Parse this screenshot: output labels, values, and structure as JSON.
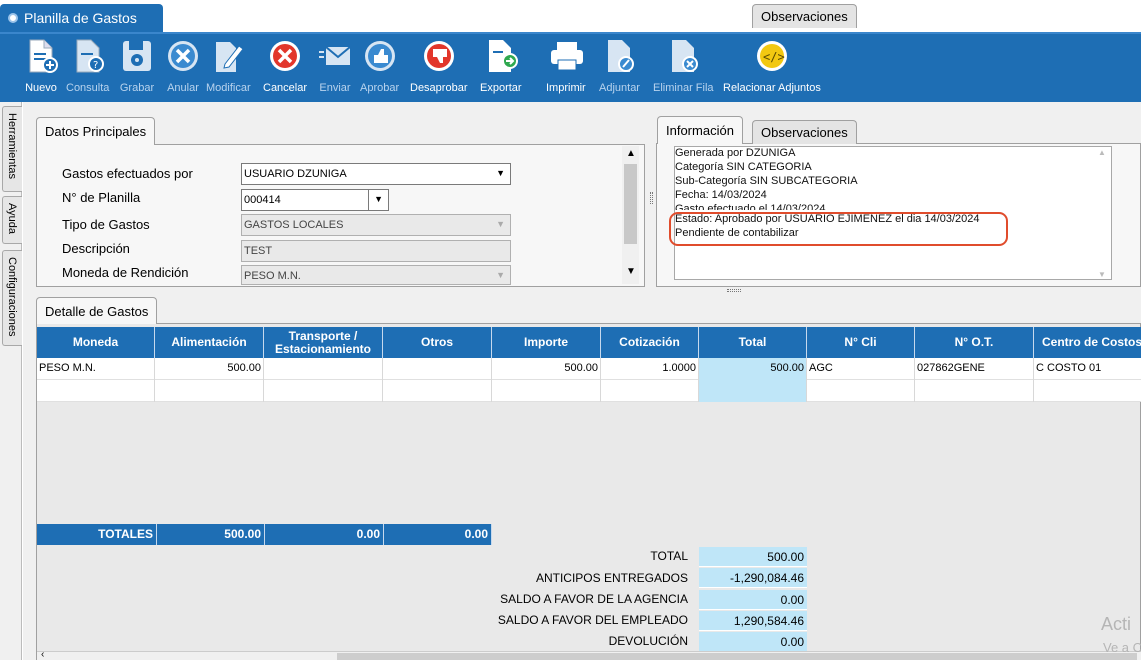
{
  "window": {
    "title": "Planilla de Gastos"
  },
  "toolbar": {
    "items": [
      {
        "label": "Nuevo",
        "icon": "new-doc-icon"
      },
      {
        "label": "Consulta",
        "icon": "query-doc-icon"
      },
      {
        "label": "Grabar",
        "icon": "save-icon"
      },
      {
        "label": "Anular",
        "icon": "cancel-x-icon"
      },
      {
        "label": "Modificar",
        "icon": "edit-icon"
      },
      {
        "label": "Cancelar",
        "icon": "cancel-icon"
      },
      {
        "label": "Enviar",
        "icon": "send-mail-icon"
      },
      {
        "label": "Aprobar",
        "icon": "thumbs-up-icon"
      },
      {
        "label": "Desaprobar",
        "icon": "thumbs-down-icon"
      },
      {
        "label": "Exportar",
        "icon": "export-icon"
      },
      {
        "label": "Imprimir",
        "icon": "printer-icon"
      },
      {
        "label": "Adjuntar",
        "icon": "attach-icon"
      },
      {
        "label": "Eliminar Fila",
        "icon": "delete-row-icon"
      },
      {
        "label": "Relacionar Adjuntos",
        "icon": "link-attachments-icon"
      }
    ]
  },
  "sidebar": {
    "tabs": [
      "Herramientas",
      "Ayuda",
      "Configuraciones"
    ]
  },
  "datos": {
    "tab": "Datos Principales",
    "gastos_por_label": "Gastos efectuados por",
    "gastos_por_value": "USUARIO DZUNIGA",
    "planilla_label": "N° de Planilla",
    "planilla_value": "000414",
    "tipo_label": "Tipo de Gastos",
    "tipo_value": "GASTOS LOCALES",
    "descripcion_label": "Descripción",
    "descripcion_value": "TEST",
    "moneda_label": "Moneda de Rendición",
    "moneda_value": "PESO M.N."
  },
  "info": {
    "tab_info": "Información",
    "tab_obs": "Observaciones",
    "lines": [
      "Generada por DZUNIGA",
      "Categoría SIN CATEGORIA",
      "Sub-Categoría SIN SUBCATEGORIA",
      "Fecha: 14/03/2024",
      "Gasto efectuado el 14/03/2024",
      "Estado: Aprobado por USUARIO EJIMENEZ el dia 14/03/2024",
      "Pendiente de contabilizar"
    ]
  },
  "detalle": {
    "tab": "Detalle de Gastos",
    "columns": [
      "Moneda",
      "Alimentación",
      "Transporte / Estacionamiento",
      "Otros",
      "Importe",
      "Cotización",
      "Total",
      "N° Cli",
      "N° O.T.",
      "Centro de Costos"
    ],
    "row": [
      "PESO M.N.",
      "500.00",
      "",
      "",
      "500.00",
      "1.0000",
      "500.00",
      "AGC",
      "027862GENE",
      "C COSTO 01"
    ],
    "totals_label": "TOTALES",
    "totals": [
      "500.00",
      "0.00",
      "0.00"
    ]
  },
  "summary": [
    {
      "label": "TOTAL",
      "value": "500.00"
    },
    {
      "label": "ANTICIPOS ENTREGADOS",
      "value": "-1,290,084.46"
    },
    {
      "label": "SALDO A FAVOR DE LA AGENCIA",
      "value": "0.00"
    },
    {
      "label": "SALDO A FAVOR DEL EMPLEADO",
      "value": "1,290,584.46"
    },
    {
      "label": "DEVOLUCIÓN",
      "value": "0.00"
    }
  ],
  "watermark": {
    "line1": "Acti",
    "line2": "Ve a C"
  }
}
